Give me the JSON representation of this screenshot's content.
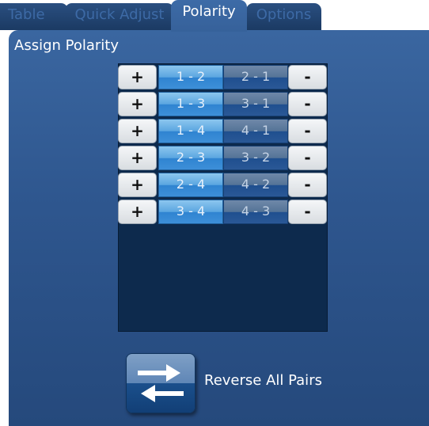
{
  "tabs": [
    {
      "label": "Table"
    },
    {
      "label": "Quick Adjust"
    },
    {
      "label": "Polarity"
    },
    {
      "label": "Options"
    }
  ],
  "active_tab": "Polarity",
  "panel": {
    "title": "Assign Polarity"
  },
  "pairs": [
    {
      "plus": "+",
      "a": "1 - 2",
      "b": "2 - 1",
      "minus": "-"
    },
    {
      "plus": "+",
      "a": "1 - 3",
      "b": "3 - 1",
      "minus": "-"
    },
    {
      "plus": "+",
      "a": "1 - 4",
      "b": "4 - 1",
      "minus": "-"
    },
    {
      "plus": "+",
      "a": "2 - 3",
      "b": "3 - 2",
      "minus": "-"
    },
    {
      "plus": "+",
      "a": "2 - 4",
      "b": "4 - 2",
      "minus": "-"
    },
    {
      "plus": "+",
      "a": "3 - 4",
      "b": "4 - 3",
      "minus": "-"
    }
  ],
  "reverse": {
    "label": "Reverse All Pairs",
    "icon": "swap-arrows-icon"
  },
  "colors": {
    "panel": "#2e568e",
    "active_tab": "#3d6ba7",
    "inactive_tab": "#1b3a63",
    "pair_a": "#5ba6e0",
    "pair_b": "#1f4f8f",
    "table_bg": "#0d2a4d"
  }
}
